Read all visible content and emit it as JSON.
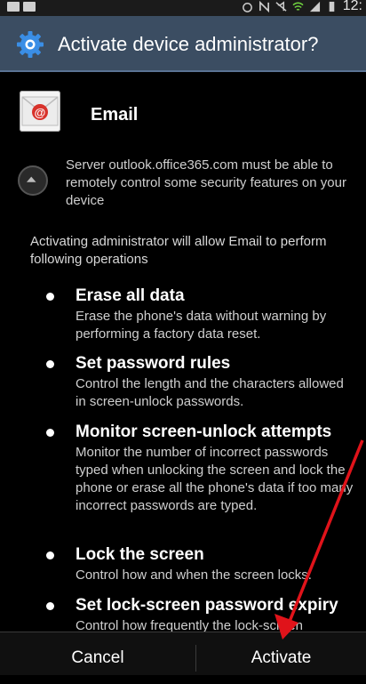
{
  "status_bar": {
    "time": "12:"
  },
  "dialog": {
    "title": "Activate device administrator?",
    "app_name": "Email",
    "server_note": "Server outlook.office365.com must be able to remotely control some security features on your device",
    "intro": "Activating administrator will allow Email to perform following operations",
    "policies": [
      {
        "title": "Erase all data",
        "description": "Erase the phone's data without warning by performing a factory data reset."
      },
      {
        "title": "Set password rules",
        "description": "Control the length and the characters allowed in screen-unlock passwords."
      },
      {
        "title": "Monitor screen-unlock attempts",
        "description": "Monitor the number of incorrect passwords typed when unlocking the screen and lock the phone or erase all the phone's data if too many incorrect passwords are typed."
      },
      {
        "title": "Lock the screen",
        "description": "Control how and when the screen locks."
      },
      {
        "title": "Set lock-screen password expiry",
        "description": "Control how frequently the lock-screen"
      }
    ]
  },
  "buttons": {
    "cancel": "Cancel",
    "activate": "Activate"
  },
  "colors": {
    "title_bar": "#3b4d62",
    "accent_blue": "#3a8ee6",
    "email_red": "#d8322b",
    "arrow_red": "#e0131a",
    "background": "#000000"
  }
}
